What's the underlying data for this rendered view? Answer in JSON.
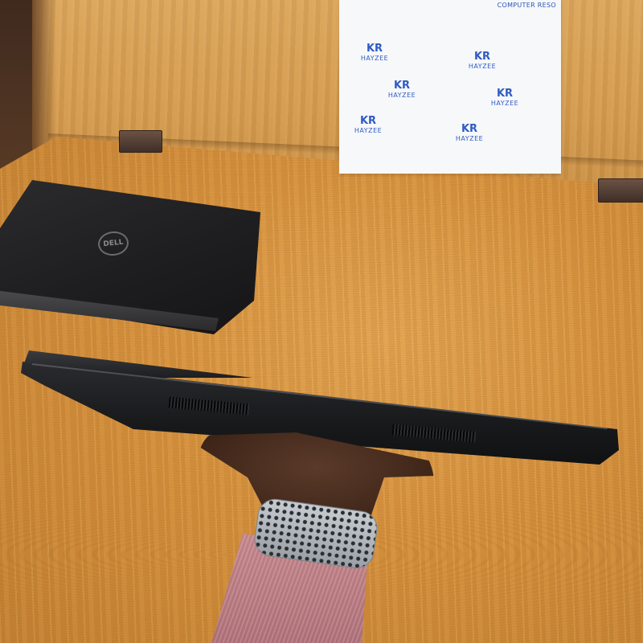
{
  "photo": {
    "alt": "Hand holding a closed black laptop edge-on over a wooden table, with a closed Dell laptop and a branded sign in the background"
  },
  "sign": {
    "header": "COMPUTER RESO",
    "logos": [
      {
        "mark": "KR",
        "word": "HAYZEE"
      },
      {
        "mark": "KR",
        "word": "HAYZEE"
      },
      {
        "mark": "KR",
        "word": "HAYZEE"
      },
      {
        "mark": "KR",
        "word": "HAYZEE"
      },
      {
        "mark": "KR",
        "word": "HAYZEE"
      },
      {
        "mark": "KR",
        "word": "HAYZEE"
      }
    ]
  },
  "dell_logo": "DELL",
  "colors": {
    "wood": "#d6923e",
    "laptop": "#1d1e21",
    "sign": "#f7f8fa",
    "logo_blue": "#2f5bc4"
  }
}
